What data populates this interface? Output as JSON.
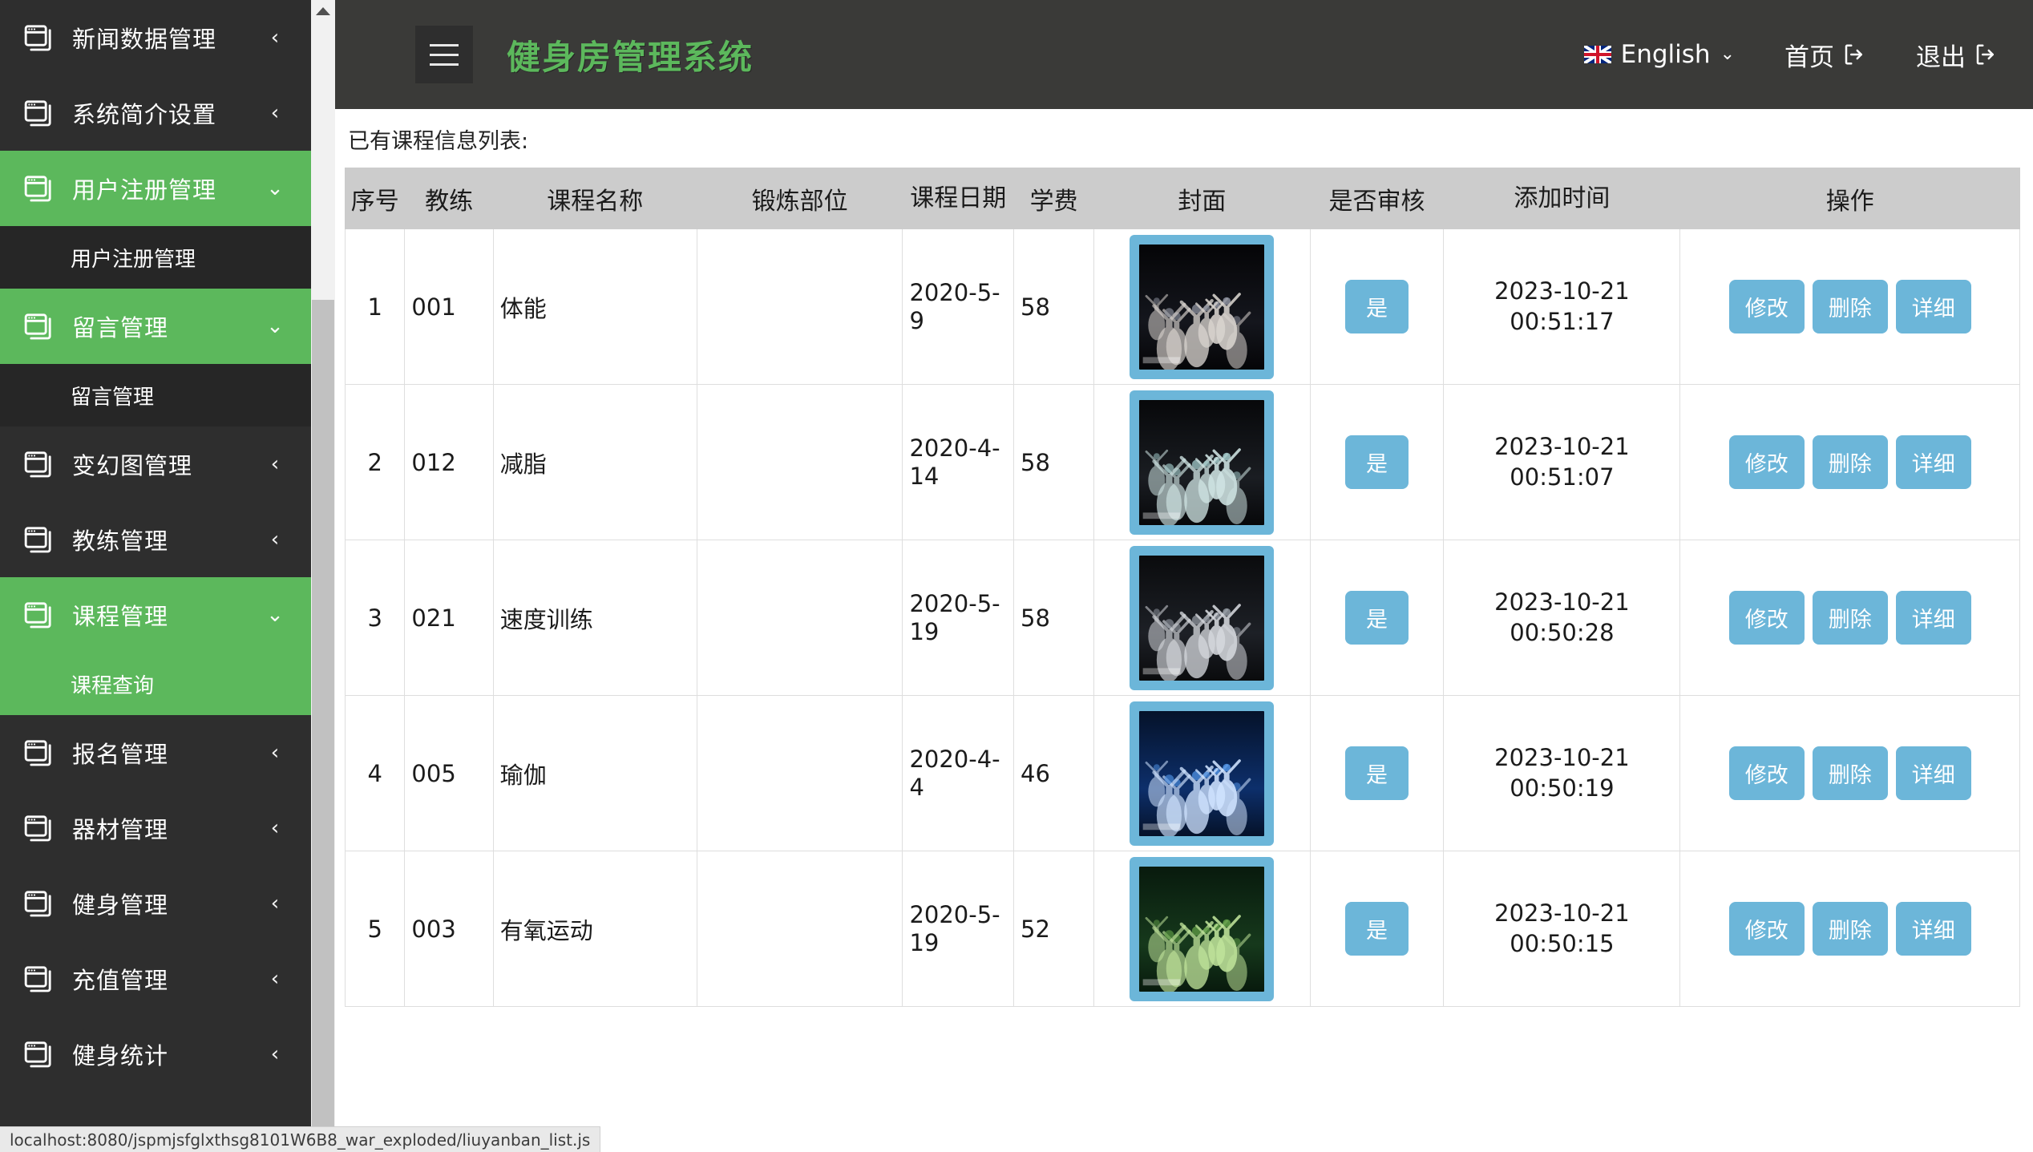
{
  "header": {
    "brand": "健身房管理系统",
    "menu_icon": "hamburger-icon",
    "language": "English",
    "language_flag": "uk-flag-icon",
    "home_label": "首页",
    "logout_label": "退出"
  },
  "sidebar": {
    "items": [
      {
        "label": "新闻数据管理",
        "state": "collapsed",
        "caret": "‹",
        "active": false,
        "sub": []
      },
      {
        "label": "系统简介设置",
        "state": "collapsed",
        "caret": "‹",
        "active": false,
        "sub": []
      },
      {
        "label": "用户注册管理",
        "state": "expanded",
        "caret": "⌄",
        "active": true,
        "sub": [
          "用户注册管理"
        ]
      },
      {
        "label": "留言管理",
        "state": "expanded",
        "caret": "⌄",
        "active": true,
        "sub": [
          "留言管理"
        ]
      },
      {
        "label": "变幻图管理",
        "state": "collapsed",
        "caret": "‹",
        "active": false,
        "sub": []
      },
      {
        "label": "教练管理",
        "state": "collapsed",
        "caret": "‹",
        "active": false,
        "sub": []
      },
      {
        "label": "课程管理",
        "state": "expanded",
        "caret": "⌄",
        "active": true,
        "sub": [
          "课程查询"
        ]
      },
      {
        "label": "报名管理",
        "state": "collapsed",
        "caret": "‹",
        "active": false,
        "sub": []
      },
      {
        "label": "器材管理",
        "state": "collapsed",
        "caret": "‹",
        "active": false,
        "sub": []
      },
      {
        "label": "健身管理",
        "state": "collapsed",
        "caret": "‹",
        "active": false,
        "sub": []
      },
      {
        "label": "充值管理",
        "state": "collapsed",
        "caret": "‹",
        "active": false,
        "sub": []
      },
      {
        "label": "健身统计",
        "state": "collapsed",
        "caret": "‹",
        "active": false,
        "sub": []
      }
    ]
  },
  "main": {
    "list_title": "已有课程信息列表:",
    "columns": [
      "序号",
      "教练",
      "课程名称",
      "锻炼部位",
      "课程日期",
      "学费",
      "封面",
      "是否审核",
      "添加时间",
      "操作"
    ],
    "ops": {
      "edit": "修改",
      "delete": "删除",
      "detail": "详细"
    },
    "rows": [
      {
        "index": "1",
        "coach": "001",
        "name": "体能",
        "part": "",
        "date": "2020-5-9",
        "fee": "58",
        "cover": "dance-troupe-white-costumes-dark-stage",
        "audit": "是",
        "time_date": "2023-10-21",
        "time_clock": "00:51:17"
      },
      {
        "index": "2",
        "coach": "012",
        "name": "减脂",
        "part": "",
        "date": "2020-4-14",
        "fee": "58",
        "cover": "ballet-dancers-pale-blue-tutus",
        "audit": "是",
        "time_date": "2023-10-21",
        "time_clock": "00:51:07"
      },
      {
        "index": "3",
        "coach": "021",
        "name": "速度训练",
        "part": "",
        "date": "2020-5-19",
        "fee": "58",
        "cover": "ballet-group-grey-dresses",
        "audit": "是",
        "time_date": "2023-10-21",
        "time_clock": "00:50:28"
      },
      {
        "index": "4",
        "coach": "005",
        "name": "瑜伽",
        "part": "",
        "date": "2020-4-4",
        "fee": "46",
        "cover": "blue-stage-dance-poster",
        "audit": "是",
        "time_date": "2023-10-21",
        "time_clock": "00:50:19"
      },
      {
        "index": "5",
        "coach": "003",
        "name": "有氧运动",
        "part": "",
        "date": "2020-5-19",
        "fee": "52",
        "cover": "green-costume-dance-outdoor",
        "audit": "是",
        "time_date": "2023-10-21",
        "time_clock": "00:50:15"
      }
    ]
  },
  "statusbar": {
    "url": "localhost:8080/jspmjsfglxthsg8101W6B8_war_exploded/liuyanban_list.js"
  },
  "colors": {
    "sidebar_bg": "#2e2e2e",
    "sidebar_sub_bg": "#262626",
    "accent_green": "#5cb85c",
    "topbar_bg": "#3a3a38",
    "button_blue": "#6cb6d9",
    "table_header_bg": "#cccccc"
  }
}
